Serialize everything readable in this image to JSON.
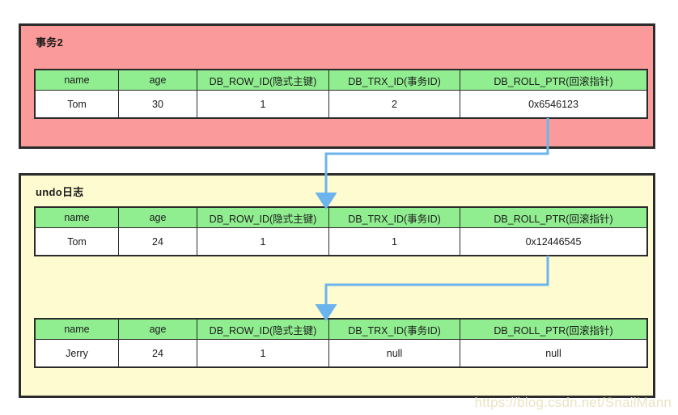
{
  "diagram": {
    "title_txn": "事务2",
    "title_undo": "undo日志",
    "watermark": "https://blog.csdn.net/SnailMann",
    "colors": {
      "txn_box_fill": "#fb9a9a",
      "undo_box_fill": "#fdfbcf",
      "header_fill": "#90ee90",
      "row_fill": "#ffffff",
      "border": "#2b2b2b",
      "arrow": "#6cb4ee",
      "watermark": "#e7e3c0"
    },
    "columns": [
      "name",
      "age",
      "DB_ROW_ID(隐式主键)",
      "DB_TRX_ID(事务ID)",
      "DB_ROLL_PTR(回滚指针)"
    ],
    "tables": [
      {
        "id": "txn2",
        "group": "事务2",
        "row": [
          "Tom",
          "30",
          "1",
          "2",
          "0x6546123"
        ]
      },
      {
        "id": "undo-tom",
        "group": "undo日志",
        "row": [
          "Tom",
          "24",
          "1",
          "1",
          "0x12446545"
        ]
      },
      {
        "id": "undo-jerry",
        "group": "undo日志",
        "row": [
          "Jerry",
          "24",
          "1",
          "null",
          "null"
        ]
      }
    ],
    "arrows": [
      {
        "name": "roll-ptr-txn2-to-undo-tom",
        "from_table": "txn2",
        "from_column": "DB_ROLL_PTR(回滚指针)",
        "to_table": "undo-tom"
      },
      {
        "name": "roll-ptr-undo-tom-to-undo-jerry",
        "from_table": "undo-tom",
        "from_column": "DB_ROLL_PTR(回滚指针)",
        "to_table": "undo-jerry"
      }
    ]
  }
}
